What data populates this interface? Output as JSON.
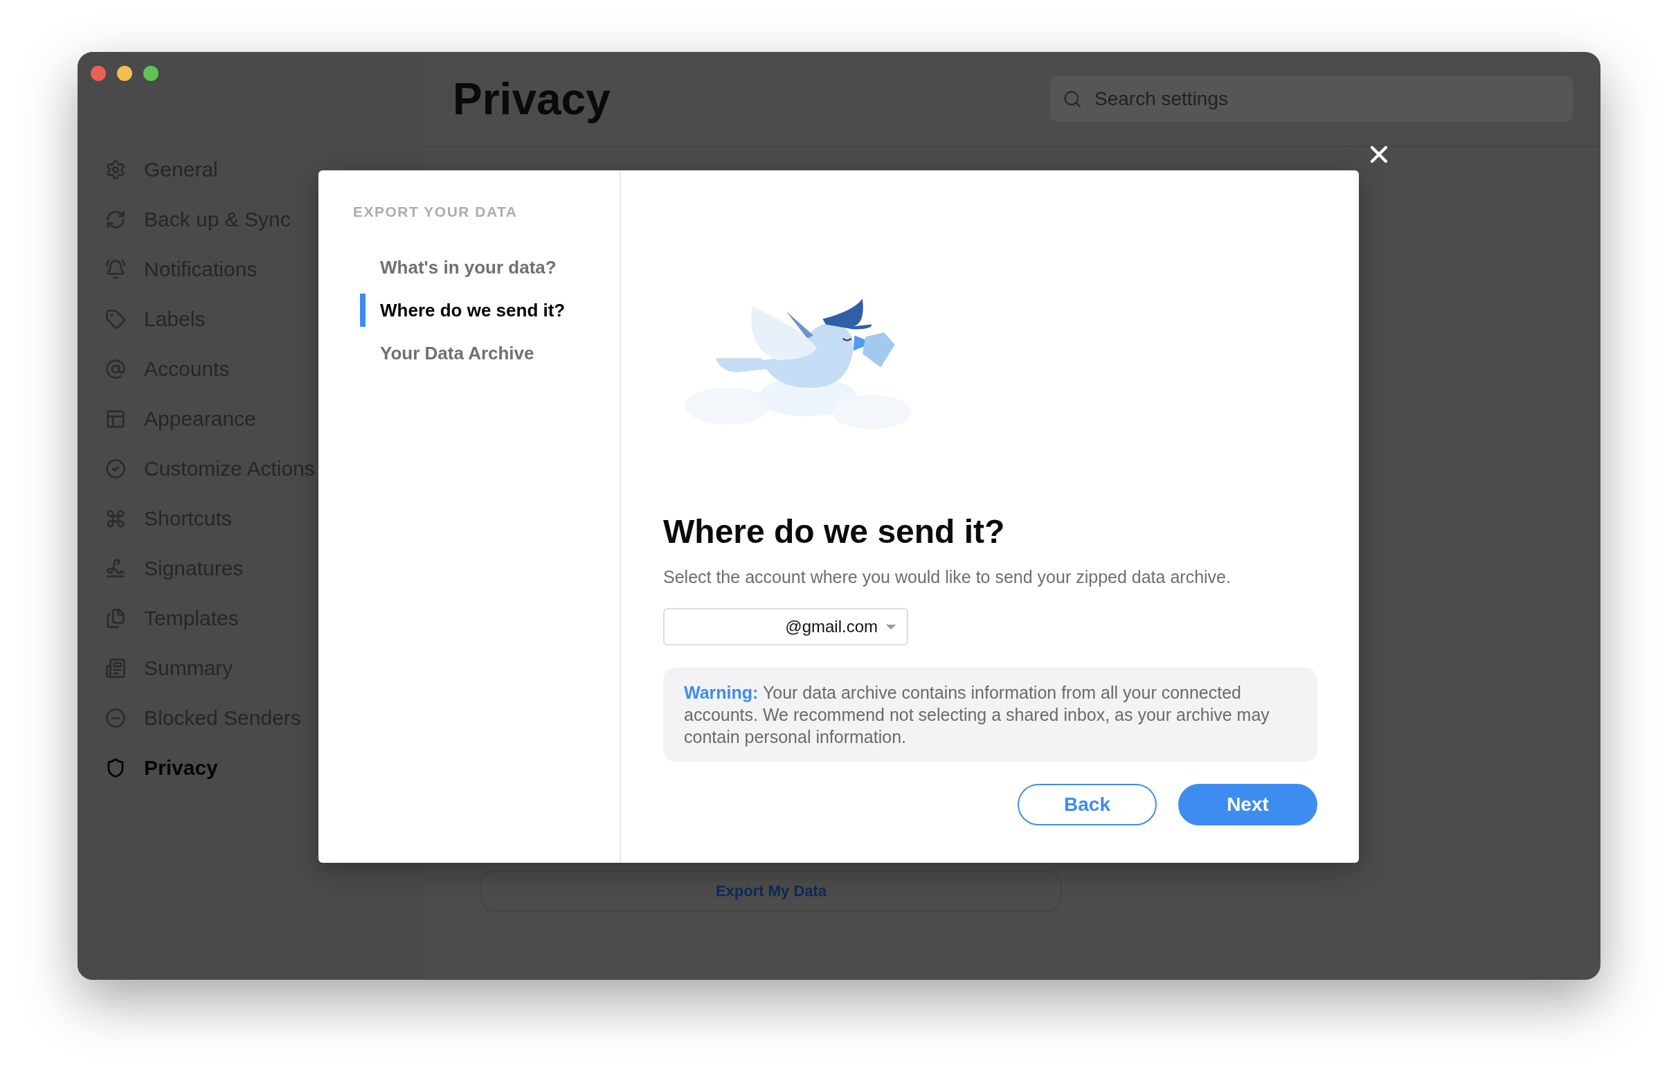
{
  "sidebar": {
    "items": [
      {
        "label": "General",
        "selected": false
      },
      {
        "label": "Back up & Sync",
        "selected": false
      },
      {
        "label": "Notifications",
        "selected": false
      },
      {
        "label": "Labels",
        "selected": false
      },
      {
        "label": "Accounts",
        "selected": false
      },
      {
        "label": "Appearance",
        "selected": false
      },
      {
        "label": "Customize Actions",
        "selected": false
      },
      {
        "label": "Shortcuts",
        "selected": false
      },
      {
        "label": "Signatures",
        "selected": false
      },
      {
        "label": "Templates",
        "selected": false
      },
      {
        "label": "Summary",
        "selected": false
      },
      {
        "label": "Blocked Senders",
        "selected": false
      },
      {
        "label": "Privacy",
        "selected": true
      }
    ]
  },
  "header": {
    "title": "Privacy",
    "search": {
      "placeholder": "Search settings"
    }
  },
  "export_button": {
    "label": "Export My Data"
  },
  "modal": {
    "section_title": "EXPORT YOUR DATA",
    "steps": [
      {
        "label": "What's in your data?",
        "selected": false
      },
      {
        "label": "Where do we send it?",
        "selected": true
      },
      {
        "label": "Your Data Archive",
        "selected": false
      }
    ],
    "heading": "Where do we send it?",
    "description": "Select the account where you would like to send your zipped data archive.",
    "account_select": {
      "value": "@gmail.com"
    },
    "warning": {
      "label": "Warning:",
      "text": "Your data archive contains information from all your connected accounts. We recommend not selecting a shared inbox, as your archive may contain personal information."
    },
    "buttons": {
      "back": "Back",
      "next": "Next"
    }
  }
}
